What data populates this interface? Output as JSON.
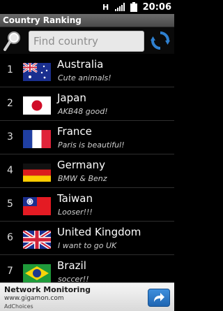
{
  "status_bar": {
    "time": "20:06",
    "icons": [
      "h-network-icon",
      "signal-icon",
      "battery-icon"
    ]
  },
  "app": {
    "title": "Country Ranking"
  },
  "search": {
    "placeholder": "Find country"
  },
  "countries": [
    {
      "rank": "1",
      "name": "Australia",
      "comment": "Cute animals!",
      "flag": "australia-flag-icon"
    },
    {
      "rank": "2",
      "name": "Japan",
      "comment": "AKB48 good!",
      "flag": "japan-flag-icon"
    },
    {
      "rank": "3",
      "name": "France",
      "comment": "Paris is beautiful!",
      "flag": "france-flag-icon"
    },
    {
      "rank": "4",
      "name": "Germany",
      "comment": "BMW & Benz",
      "flag": "germany-flag-icon"
    },
    {
      "rank": "5",
      "name": "Taiwan",
      "comment": "Looser!!!",
      "flag": "taiwan-flag-icon"
    },
    {
      "rank": "6",
      "name": "United Kingdom",
      "comment": "I want to go UK",
      "flag": "uk-flag-icon"
    },
    {
      "rank": "7",
      "name": "Brazil",
      "comment": "soccer!!",
      "flag": "brazil-flag-icon"
    }
  ],
  "ad": {
    "title": "Network Monitoring",
    "url": "www.gigamon.com",
    "choices_label": "AdChoices"
  },
  "colors": {
    "title_bar": "#5a5a5a",
    "refresh_icon": "#2f80d0",
    "ad_button": "#2a74c4"
  }
}
